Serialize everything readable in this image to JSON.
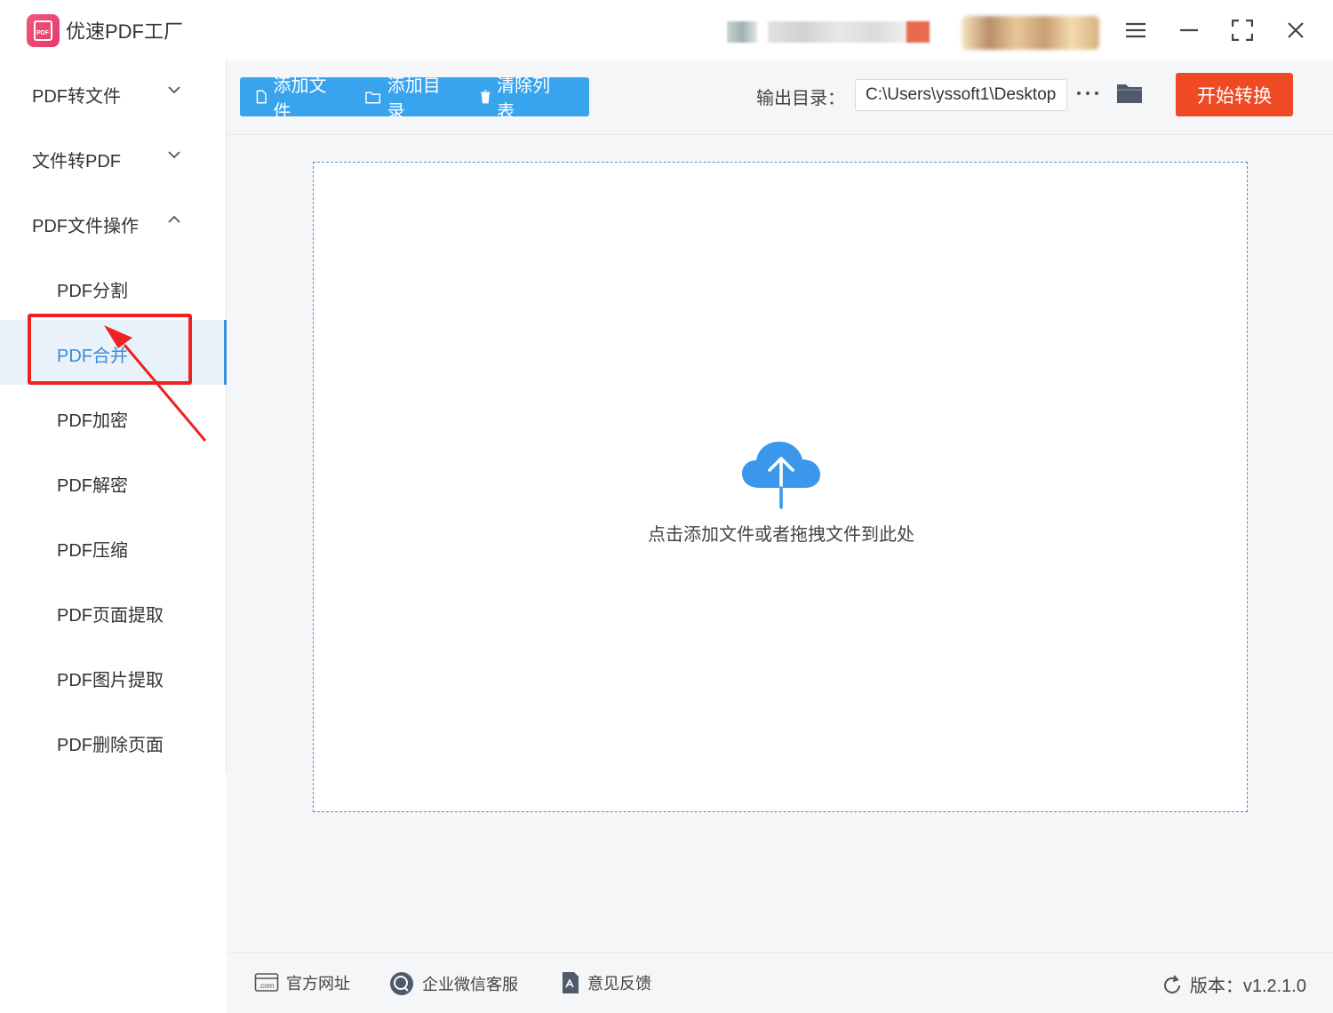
{
  "app": {
    "title": "优速PDF工厂",
    "logo_text": "PDF"
  },
  "window_controls": {
    "menu": "menu-icon",
    "minimize": "minimize-icon",
    "maximize": "maximize-icon",
    "close": "close-icon"
  },
  "sidebar": {
    "groups": [
      {
        "label": "PDF转文件",
        "expanded": false
      },
      {
        "label": "文件转PDF",
        "expanded": false
      },
      {
        "label": "PDF文件操作",
        "expanded": true
      }
    ],
    "items": [
      {
        "label": "PDF分割",
        "active": false
      },
      {
        "label": "PDF合并",
        "active": true
      },
      {
        "label": "PDF加密",
        "active": false
      },
      {
        "label": "PDF解密",
        "active": false
      },
      {
        "label": "PDF压缩",
        "active": false
      },
      {
        "label": "PDF页面提取",
        "active": false
      },
      {
        "label": "PDF图片提取",
        "active": false
      },
      {
        "label": "PDF删除页面",
        "active": false
      }
    ]
  },
  "toolbar": {
    "add_file": "添加文件",
    "add_folder": "添加目录",
    "clear_list": "清除列表",
    "output_label": "输出目录：",
    "output_path": "C:\\Users\\yssoft1\\Desktop",
    "start": "开始转换"
  },
  "dropzone": {
    "text": "点击添加文件或者拖拽文件到此处"
  },
  "footer": {
    "website": "官方网址",
    "wechat": "企业微信客服",
    "feedback": "意见反馈",
    "version": "版本：v1.2.1.0"
  },
  "colors": {
    "accent": "#38a4ee",
    "start_button": "#ef4a24",
    "active_item": "#3b8ad6",
    "annotation": "#ee2222"
  }
}
